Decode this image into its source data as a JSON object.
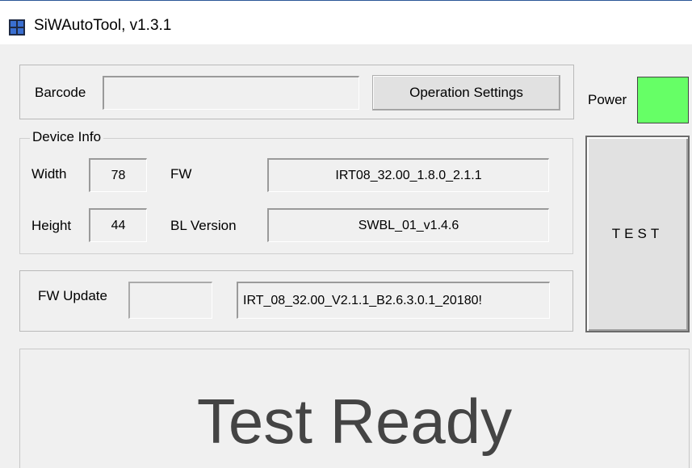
{
  "window": {
    "title": "SiWAutoTool, v1.3.1"
  },
  "barcode": {
    "label": "Barcode",
    "value": ""
  },
  "operation_settings": {
    "label": "Operation Settings"
  },
  "power": {
    "label": "Power",
    "status_color": "#66ff66"
  },
  "device_info": {
    "group_label": "Device Info",
    "width_label": "Width",
    "width_value": "78",
    "height_label": "Height",
    "height_value": "44",
    "fw_label": "FW",
    "fw_value": "IRT08_32.00_1.8.0_2.1.1",
    "bl_label": "BL Version",
    "bl_value": "SWBL_01_v1.4.6"
  },
  "fw_update": {
    "label": "FW Update",
    "status_value": "",
    "file_value": "IRT_08_32.00_V2.1.1_B2.6.3.0.1_20180!"
  },
  "test_button": {
    "label": "TEST"
  },
  "status": {
    "text": "Test Ready"
  }
}
